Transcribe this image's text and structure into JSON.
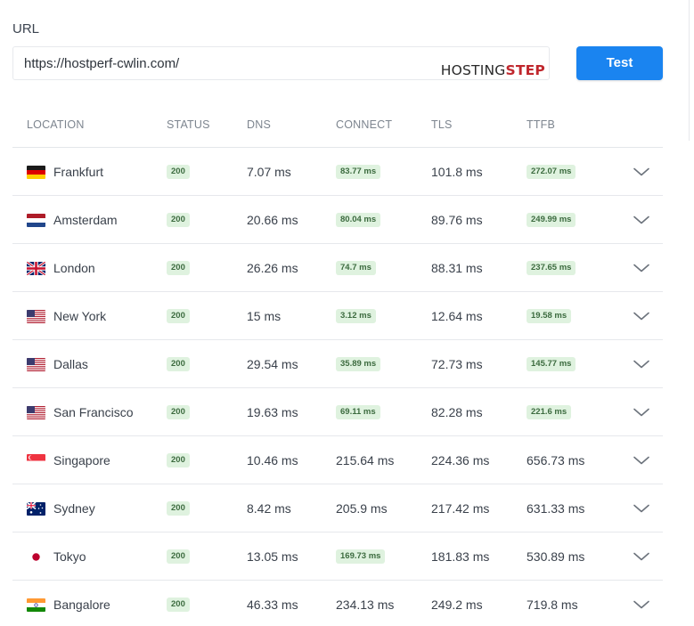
{
  "form": {
    "url_label": "URL",
    "url_value": "https://hostperf-cwlin.com/",
    "brand_part1": "HOSTING",
    "brand_part2": "STEP",
    "test_button": "Test"
  },
  "colors": {
    "accent": "#1a84f0",
    "badge_bg": "#dff2df",
    "badge_text": "#3c6b3f",
    "brand_red": "#c0272d"
  },
  "columns": [
    "LOCATION",
    "STATUS",
    "DNS",
    "CONNECT",
    "TLS",
    "TTFB"
  ],
  "rows": [
    {
      "location": "Frankfurt",
      "flag": "de",
      "status": "200",
      "dns": "7.07 ms",
      "connect": "83.77 ms",
      "connect_badge": true,
      "tls": "101.8 ms",
      "ttfb": "272.07 ms",
      "ttfb_badge": true
    },
    {
      "location": "Amsterdam",
      "flag": "nl",
      "status": "200",
      "dns": "20.66 ms",
      "connect": "80.04 ms",
      "connect_badge": true,
      "tls": "89.76 ms",
      "ttfb": "249.99 ms",
      "ttfb_badge": true
    },
    {
      "location": "London",
      "flag": "gb",
      "status": "200",
      "dns": "26.26 ms",
      "connect": "74.7 ms",
      "connect_badge": true,
      "tls": "88.31 ms",
      "ttfb": "237.65 ms",
      "ttfb_badge": true
    },
    {
      "location": "New York",
      "flag": "us",
      "status": "200",
      "dns": "15 ms",
      "connect": "3.12 ms",
      "connect_badge": true,
      "tls": "12.64 ms",
      "ttfb": "19.58 ms",
      "ttfb_badge": true
    },
    {
      "location": "Dallas",
      "flag": "us",
      "status": "200",
      "dns": "29.54 ms",
      "connect": "35.89 ms",
      "connect_badge": true,
      "tls": "72.73 ms",
      "ttfb": "145.77 ms",
      "ttfb_badge": true
    },
    {
      "location": "San Francisco",
      "flag": "us",
      "status": "200",
      "dns": "19.63 ms",
      "connect": "69.11 ms",
      "connect_badge": true,
      "tls": "82.28 ms",
      "ttfb": "221.6 ms",
      "ttfb_badge": true
    },
    {
      "location": "Singapore",
      "flag": "sg",
      "status": "200",
      "dns": "10.46 ms",
      "connect": "215.64 ms",
      "connect_badge": false,
      "tls": "224.36 ms",
      "ttfb": "656.73 ms",
      "ttfb_badge": false
    },
    {
      "location": "Sydney",
      "flag": "au",
      "status": "200",
      "dns": "8.42 ms",
      "connect": "205.9 ms",
      "connect_badge": false,
      "tls": "217.42 ms",
      "ttfb": "631.33 ms",
      "ttfb_badge": false
    },
    {
      "location": "Tokyo",
      "flag": "jp",
      "status": "200",
      "dns": "13.05 ms",
      "connect": "169.73 ms",
      "connect_badge": true,
      "tls": "181.83 ms",
      "ttfb": "530.89 ms",
      "ttfb_badge": false
    },
    {
      "location": "Bangalore",
      "flag": "in",
      "status": "200",
      "dns": "46.33 ms",
      "connect": "234.13 ms",
      "connect_badge": false,
      "tls": "249.2 ms",
      "ttfb": "719.8 ms",
      "ttfb_badge": false
    }
  ]
}
